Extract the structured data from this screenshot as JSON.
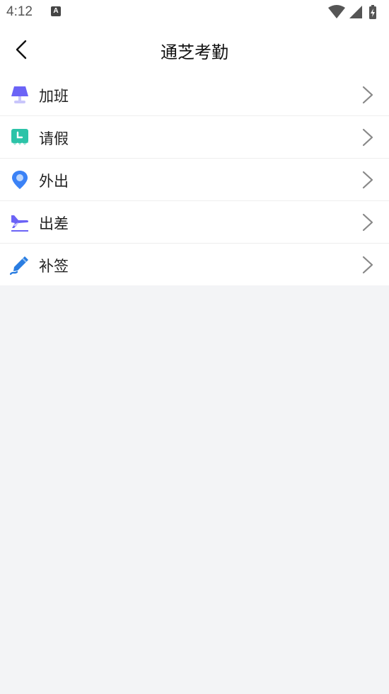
{
  "status_bar": {
    "time": "4:12",
    "notification_icon": "a-keyboard-icon",
    "indicators": [
      "wifi-icon",
      "cell-signal-icon",
      "battery-charging-icon"
    ]
  },
  "header": {
    "title": "通芝考勤",
    "back_icon": "back-arrow-icon"
  },
  "menu": {
    "items": [
      {
        "label": "加班",
        "icon": "lamp-icon",
        "icon_color": "#6b63f6"
      },
      {
        "label": "请假",
        "icon": "calendar-leave-icon",
        "icon_color": "#2cc3a8"
      },
      {
        "label": "外出",
        "icon": "location-pin-icon",
        "icon_color": "#3b82f6"
      },
      {
        "label": "出差",
        "icon": "airplane-icon",
        "icon_color": "#6b63f6"
      },
      {
        "label": "补签",
        "icon": "pen-sign-icon",
        "icon_color": "#2a7de1"
      }
    ],
    "chevron_icon": "chevron-right-icon"
  },
  "colors": {
    "background": "#f3f4f6",
    "surface": "#ffffff",
    "divider": "#eeeeee",
    "chevron": "#888888"
  }
}
